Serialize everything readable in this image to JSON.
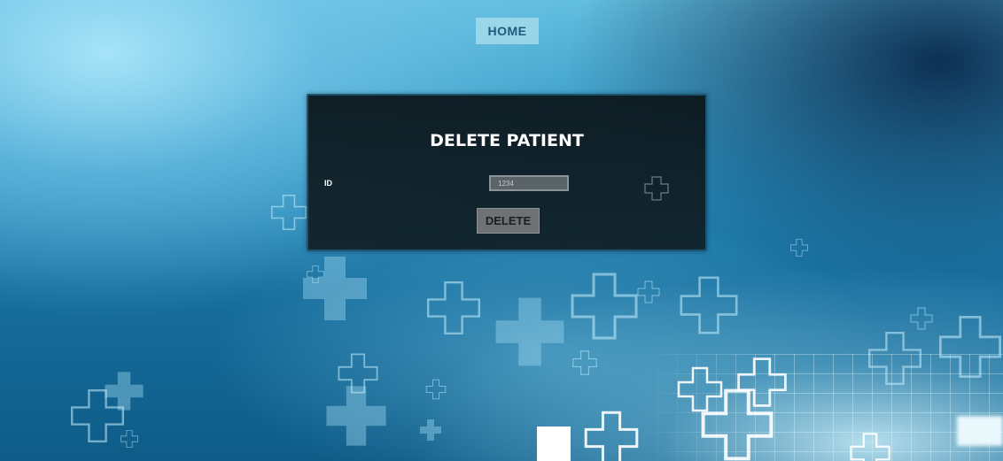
{
  "nav": {
    "home_label": "HOME"
  },
  "form": {
    "title": "DELETE PATIENT",
    "id_label": "ID",
    "id_value": "1234",
    "delete_label": "DELETE"
  },
  "colors": {
    "panel_background": "#12222a",
    "panel_border": "#1c5570",
    "button_gray": "#6e7275",
    "home_button": "#b4e1f0"
  },
  "icons": {
    "decor": "medical-cross-icon"
  }
}
